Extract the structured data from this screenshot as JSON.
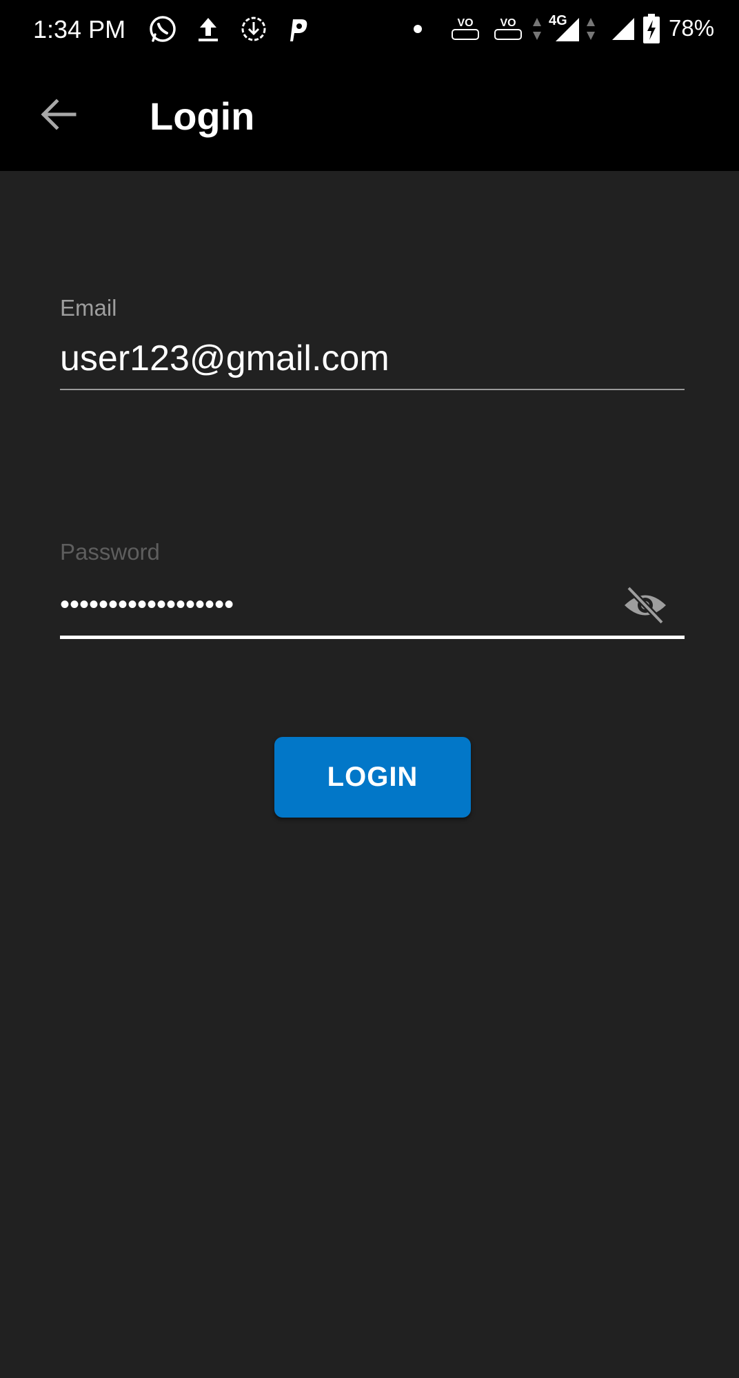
{
  "status_bar": {
    "time": "1:34 PM",
    "icons": [
      "whatsapp-icon",
      "upload-icon",
      "download-sync-icon",
      "p-app-icon",
      "dot-icon",
      "volte1-icon",
      "volte2-icon",
      "network-4g-icon",
      "signal-icon",
      "battery-charging-icon"
    ],
    "network": "4G",
    "volte1": "VO",
    "volte2": "VO",
    "battery": "78%"
  },
  "app_bar": {
    "back_icon": "arrow-back-icon",
    "title": "Login"
  },
  "form": {
    "email_label": "Email",
    "email_value": "user123@gmail.com",
    "password_label": "Password",
    "password_value": "••••••••••••••••••",
    "visibility_icon": "visibility-off-icon",
    "login_label": "LOGIN"
  },
  "colors": {
    "background": "#212121",
    "app_bar": "#000000",
    "accent": "#0277c8",
    "label": "#9e9e9e"
  }
}
